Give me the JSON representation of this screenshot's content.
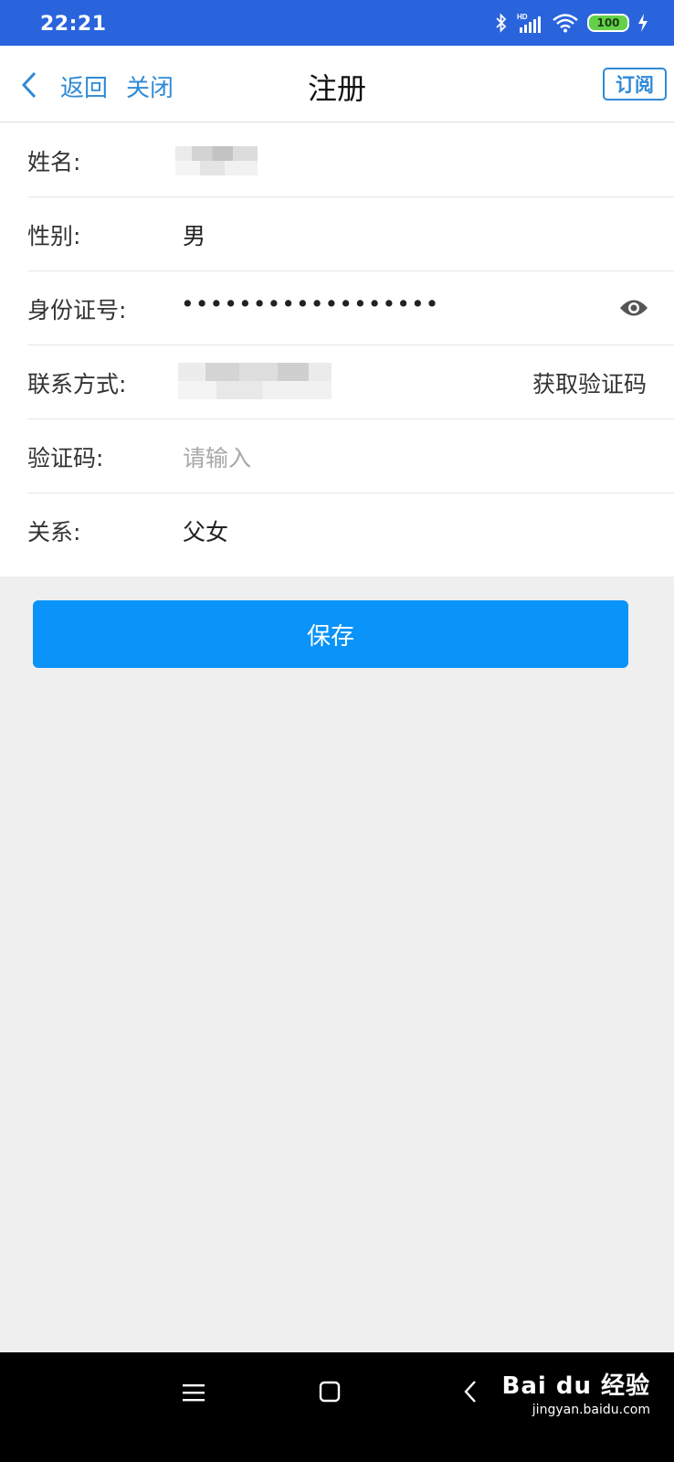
{
  "status_bar": {
    "time": "22:21",
    "battery": "100",
    "icons": [
      "bluetooth-icon",
      "signal-hd-icon",
      "wifi-icon",
      "battery-icon",
      "charging-icon"
    ]
  },
  "nav": {
    "back_label": "返回",
    "close_label": "关闭",
    "title": "注册",
    "subscribe_label": "订阅"
  },
  "form": {
    "name": {
      "label": "姓名:"
    },
    "gender": {
      "label": "性别:",
      "value": "男"
    },
    "id_number": {
      "label": "身份证号:",
      "value": "••••••••••••••••••"
    },
    "contact": {
      "label": "联系方式:",
      "action": "获取验证码"
    },
    "code": {
      "label": "验证码:",
      "placeholder": "请输入"
    },
    "relation": {
      "label": "关系:",
      "value": "父女"
    }
  },
  "save_label": "保存",
  "watermark": {
    "logo": "Bai du 经验",
    "url": "jingyan.baidu.com"
  },
  "colors": {
    "status_bar": "#2a64dc",
    "accent": "#2f8ad6",
    "primary_button": "#0a93f8",
    "background": "#efefef"
  }
}
